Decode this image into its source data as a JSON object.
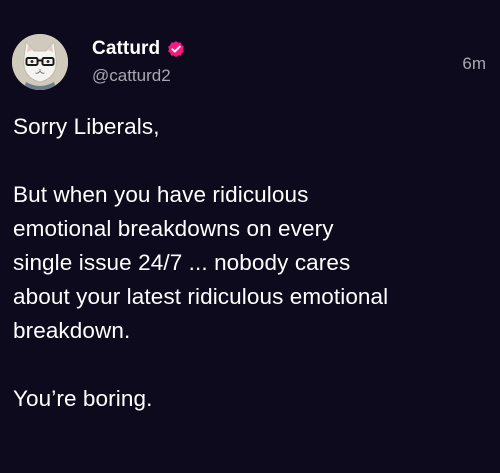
{
  "author": {
    "display_name": "Catturd",
    "handle": "@catturd2",
    "verified": true,
    "avatar_icon": "cat-with-glasses-avatar"
  },
  "timestamp": "6m",
  "text": {
    "line1": "Sorry Liberals,",
    "para2": [
      "But when you have ridiculous",
      "emotional breakdowns on every",
      "single issue 24/7 ... nobody cares",
      "about your latest ridiculous emotional",
      "breakdown."
    ],
    "line3": "You’re boring."
  },
  "colors": {
    "background": "#0e0a1d",
    "verified_badge": "#f91880",
    "secondary_text": "#a9a7b3"
  }
}
